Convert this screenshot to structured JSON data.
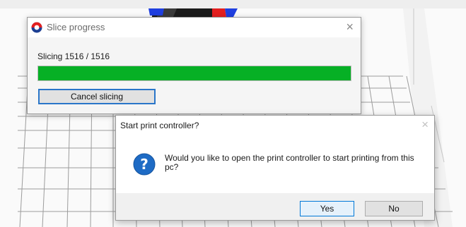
{
  "slice_progress": {
    "title": "Slice progress",
    "close_glyph": "×",
    "status": "Slicing 1516 / 1516",
    "progress_value": 1516,
    "progress_total": 1516,
    "cancel_label": "Cancel slicing",
    "icon": "app-logo-icon"
  },
  "print_dialog": {
    "title": "Start print controller?",
    "close_glyph": "×",
    "message": "Would you like to open the print controller to start printing from this pc?",
    "icon": "question-icon",
    "yes_label": "Yes",
    "no_label": "No"
  },
  "colors": {
    "progress_fill": "#06b025",
    "focus_border": "#2a76c9",
    "question_icon": "#1e6bc5",
    "model_red": "#e31f1f",
    "model_blue": "#1f3fe0"
  }
}
